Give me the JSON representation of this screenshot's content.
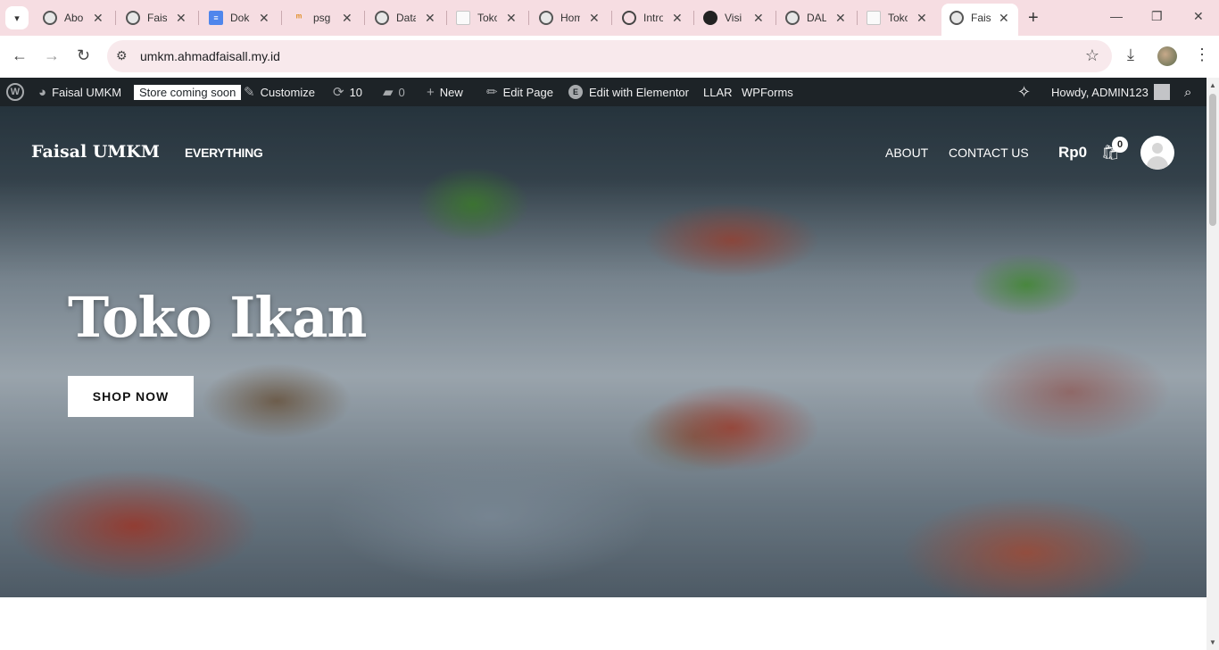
{
  "browser": {
    "tabs": [
      {
        "title": "About",
        "icon": "globe-icon"
      },
      {
        "title": "Faisal",
        "icon": "globe-icon"
      },
      {
        "title": "Dokumen",
        "icon": "docs-icon"
      },
      {
        "title": "psg",
        "icon": "psg-icon"
      },
      {
        "title": "Data",
        "icon": "globe-icon"
      },
      {
        "title": "Toko",
        "icon": "page-icon"
      },
      {
        "title": "Home",
        "icon": "globe-icon"
      },
      {
        "title": "Intro",
        "icon": "openai-icon"
      },
      {
        "title": "Visi",
        "icon": "dark-icon"
      },
      {
        "title": "DAL",
        "icon": "globe-icon"
      },
      {
        "title": "Toko",
        "icon": "page-icon"
      },
      {
        "title": "Faisal",
        "icon": "globe-icon"
      }
    ],
    "url": "umkm.ahmadfaisall.my.id"
  },
  "adminbar": {
    "site_name": "Faisal UMKM",
    "coming_soon": "Store coming soon",
    "customize": "Customize",
    "updates_count": "10",
    "comments_count": "0",
    "new": "New",
    "edit_page": "Edit Page",
    "edit_elementor": "Edit with Elementor",
    "llar": "LLAR",
    "wpforms": "WPForms",
    "howdy": "Howdy, ADMIN123"
  },
  "site": {
    "title": "Faisal UMKM",
    "nav": {
      "everything": "EVERYTHING",
      "about": "ABOUT",
      "contact": "CONTACT US"
    },
    "cart_total": "Rp0",
    "cart_count": "0"
  },
  "hero": {
    "title": "Toko Ikan",
    "button": "SHOP NOW"
  }
}
